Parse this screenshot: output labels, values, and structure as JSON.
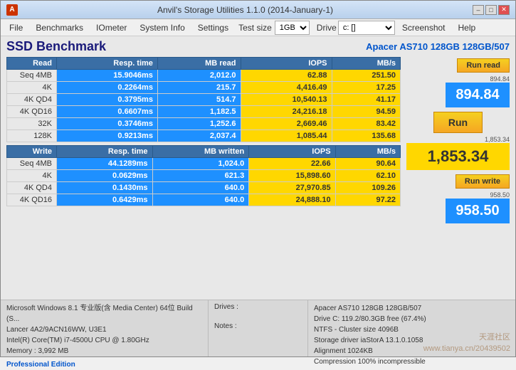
{
  "window": {
    "title": "Anvil's Storage Utilities 1.1.0 (2014-January-1)",
    "controls": {
      "minimize": "–",
      "maximize": "□",
      "close": "✕"
    }
  },
  "menu": {
    "file": "File",
    "benchmarks": "Benchmarks",
    "iometer": "IOmeter",
    "system_info": "System Info",
    "settings": "Settings",
    "test_size_label": "Test size",
    "test_size_value": "1GB",
    "drive_label": "Drive",
    "drive_value": "c: []",
    "screenshot": "Screenshot",
    "help": "Help"
  },
  "header": {
    "ssd_title": "SSD Benchmark",
    "device_name": "Apacer AS710 128GB 128GB/507"
  },
  "read_table": {
    "headers": [
      "Read",
      "Resp. time",
      "MB read",
      "IOPS",
      "MB/s"
    ],
    "rows": [
      {
        "label": "Seq 4MB",
        "resp": "15.9046ms",
        "mb": "2,012.0",
        "iops": "62.88",
        "mbs": "251.50"
      },
      {
        "label": "4K",
        "resp": "0.2264ms",
        "mb": "215.7",
        "iops": "4,416.49",
        "mbs": "17.25"
      },
      {
        "label": "4K QD4",
        "resp": "0.3795ms",
        "mb": "514.7",
        "iops": "10,540.13",
        "mbs": "41.17"
      },
      {
        "label": "4K QD16",
        "resp": "0.6607ms",
        "mb": "1,182.5",
        "iops": "24,216.18",
        "mbs": "94.59"
      },
      {
        "label": "32K",
        "resp": "0.3746ms",
        "mb": "1,252.6",
        "iops": "2,669.46",
        "mbs": "83.42"
      },
      {
        "label": "128K",
        "resp": "0.9213ms",
        "mb": "2,037.4",
        "iops": "1,085.44",
        "mbs": "135.68"
      }
    ]
  },
  "write_table": {
    "headers": [
      "Write",
      "Resp. time",
      "MB written",
      "IOPS",
      "MB/s"
    ],
    "rows": [
      {
        "label": "Seq 4MB",
        "resp": "44.1289ms",
        "mb": "1,024.0",
        "iops": "22.66",
        "mbs": "90.64"
      },
      {
        "label": "4K",
        "resp": "0.0629ms",
        "mb": "621.3",
        "iops": "15,898.60",
        "mbs": "62.10"
      },
      {
        "label": "4K QD4",
        "resp": "0.1430ms",
        "mb": "640.0",
        "iops": "27,970.85",
        "mbs": "109.26"
      },
      {
        "label": "4K QD16",
        "resp": "0.6429ms",
        "mb": "640.0",
        "iops": "24,888.10",
        "mbs": "97.22"
      }
    ]
  },
  "scores": {
    "read_small": "894.84",
    "read_large": "894.84",
    "overall_small": "1,853.34",
    "overall_large": "1,853.34",
    "write_small": "958.50",
    "write_large": "958.50",
    "run_label": "Run",
    "run_read_label": "Run read",
    "run_write_label": "Run write"
  },
  "footer": {
    "os": "Microsoft Windows 8.1 专业版(含 Media Center) 64位 Build (S...",
    "lancer": "Lancer 4A2/9ACN16WW, U3E1",
    "cpu": "Intel(R) Core(TM) i7-4500U CPU @ 1.80GHz",
    "memory": "Memory : 3,992 MB",
    "pro_edition": "Professional Edition",
    "drives_label": "Drives :",
    "notes_label": "Notes :",
    "device_info": "Apacer AS710 128GB 128GB/507",
    "drive_c": "Drive C: 119.2/80.3GB free (67.4%)",
    "ntfs": "NTFS - Cluster size 4096B",
    "storage_driver": "Storage driver  iaStorA 13.1.0.1058",
    "alignment": "Alignment 1024KB",
    "compression": "Compression 100% incompressible",
    "watermark": "天涯社区\nwww.tianya.cn/20439502"
  }
}
